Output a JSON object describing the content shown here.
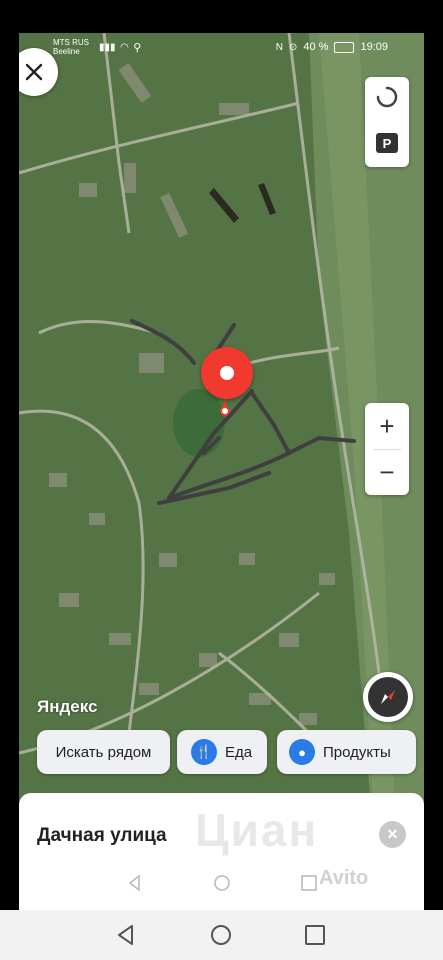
{
  "status_bar": {
    "carrier": "MTS RUS",
    "carrier2": "Beeline",
    "battery": "40 %",
    "time": "19:09"
  },
  "map": {
    "attribution": "Яндекс"
  },
  "controls": {
    "parking_label": "P",
    "zoom_in": "+",
    "zoom_out": "−"
  },
  "chips": [
    {
      "label": "Искать рядом",
      "icon": null
    },
    {
      "label": "Еда",
      "icon": "food-icon"
    },
    {
      "label": "Продукты",
      "icon": "groceries-icon"
    }
  ],
  "sheet": {
    "title": "Дачная улица",
    "watermark": "Циан",
    "avito": "Avito"
  },
  "colors": {
    "pin": "#f03a2f",
    "accent": "#2b7be5",
    "road": "#444444"
  }
}
